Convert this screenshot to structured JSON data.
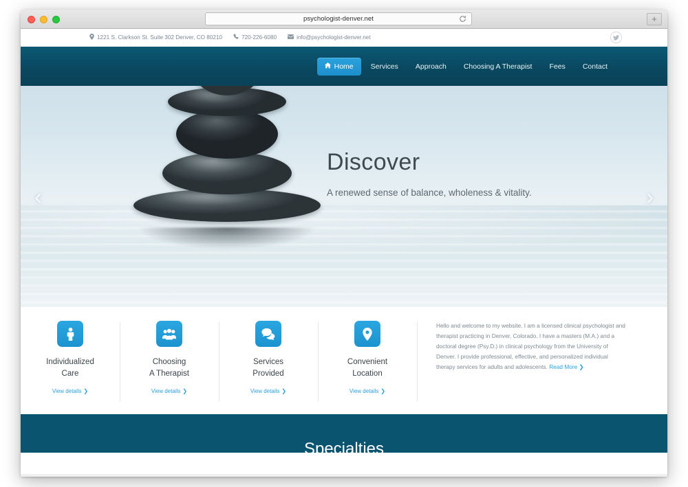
{
  "browser": {
    "url": "psychologist-denver.net",
    "reload_icon": "reload-icon",
    "newtab_label": "+",
    "traffic_lights": [
      "close",
      "minimize",
      "maximize"
    ]
  },
  "topbar": {
    "address": "1221 S. Clarkson St. Suite 302 Denver, CO 80210",
    "phone": "720-226-6080",
    "email": "info@psychologist-denver.net",
    "social": "twitter-icon"
  },
  "nav": {
    "items": [
      {
        "label": "Home",
        "active": true,
        "icon": "home-icon"
      },
      {
        "label": "Services",
        "active": false
      },
      {
        "label": "Approach",
        "active": false
      },
      {
        "label": "Choosing A Therapist",
        "active": false
      },
      {
        "label": "Fees",
        "active": false
      },
      {
        "label": "Contact",
        "active": false
      }
    ]
  },
  "hero": {
    "title": "Discover",
    "subtitle": "A renewed sense of balance, wholeness & vitality.",
    "prev_arrow": "‹",
    "next_arrow": "›"
  },
  "features": {
    "link_label": "View details",
    "chevron": "❯",
    "cards": [
      {
        "title": "Individualized\nCare",
        "title_line1": "Individualized",
        "title_line2": "Care",
        "icon": "person-icon"
      },
      {
        "title": "Choosing A Therapist",
        "title_line1": "Choosing",
        "title_line2": "A Therapist",
        "icon": "group-icon"
      },
      {
        "title": "Services Provided",
        "title_line1": "Services",
        "title_line2": "Provided",
        "icon": "chat-bubbles-icon"
      },
      {
        "title": "Convenient Location",
        "title_line1": "Convenient",
        "title_line2": "Location",
        "icon": "map-pin-icon"
      }
    ]
  },
  "welcome": {
    "body": "Hello and welcome to my website. I am a licensed clinical psychologist and therapist practicing in Denver, Colorado. I have a masters (M.A.) and a doctoral degree (Psy.D.) in clinical psychology from the University of Denver. I provide professional, effective, and personalized individual therapy services for adults and adolescents. ",
    "read_more": "Read More",
    "read_more_chevron": "❯"
  },
  "specialties": {
    "title": "Specialties"
  },
  "colors": {
    "nav_dark": "#09485f",
    "accent_blue": "#2b9fd9",
    "band_teal": "#0b5470",
    "text_grey": "#7d8990"
  }
}
